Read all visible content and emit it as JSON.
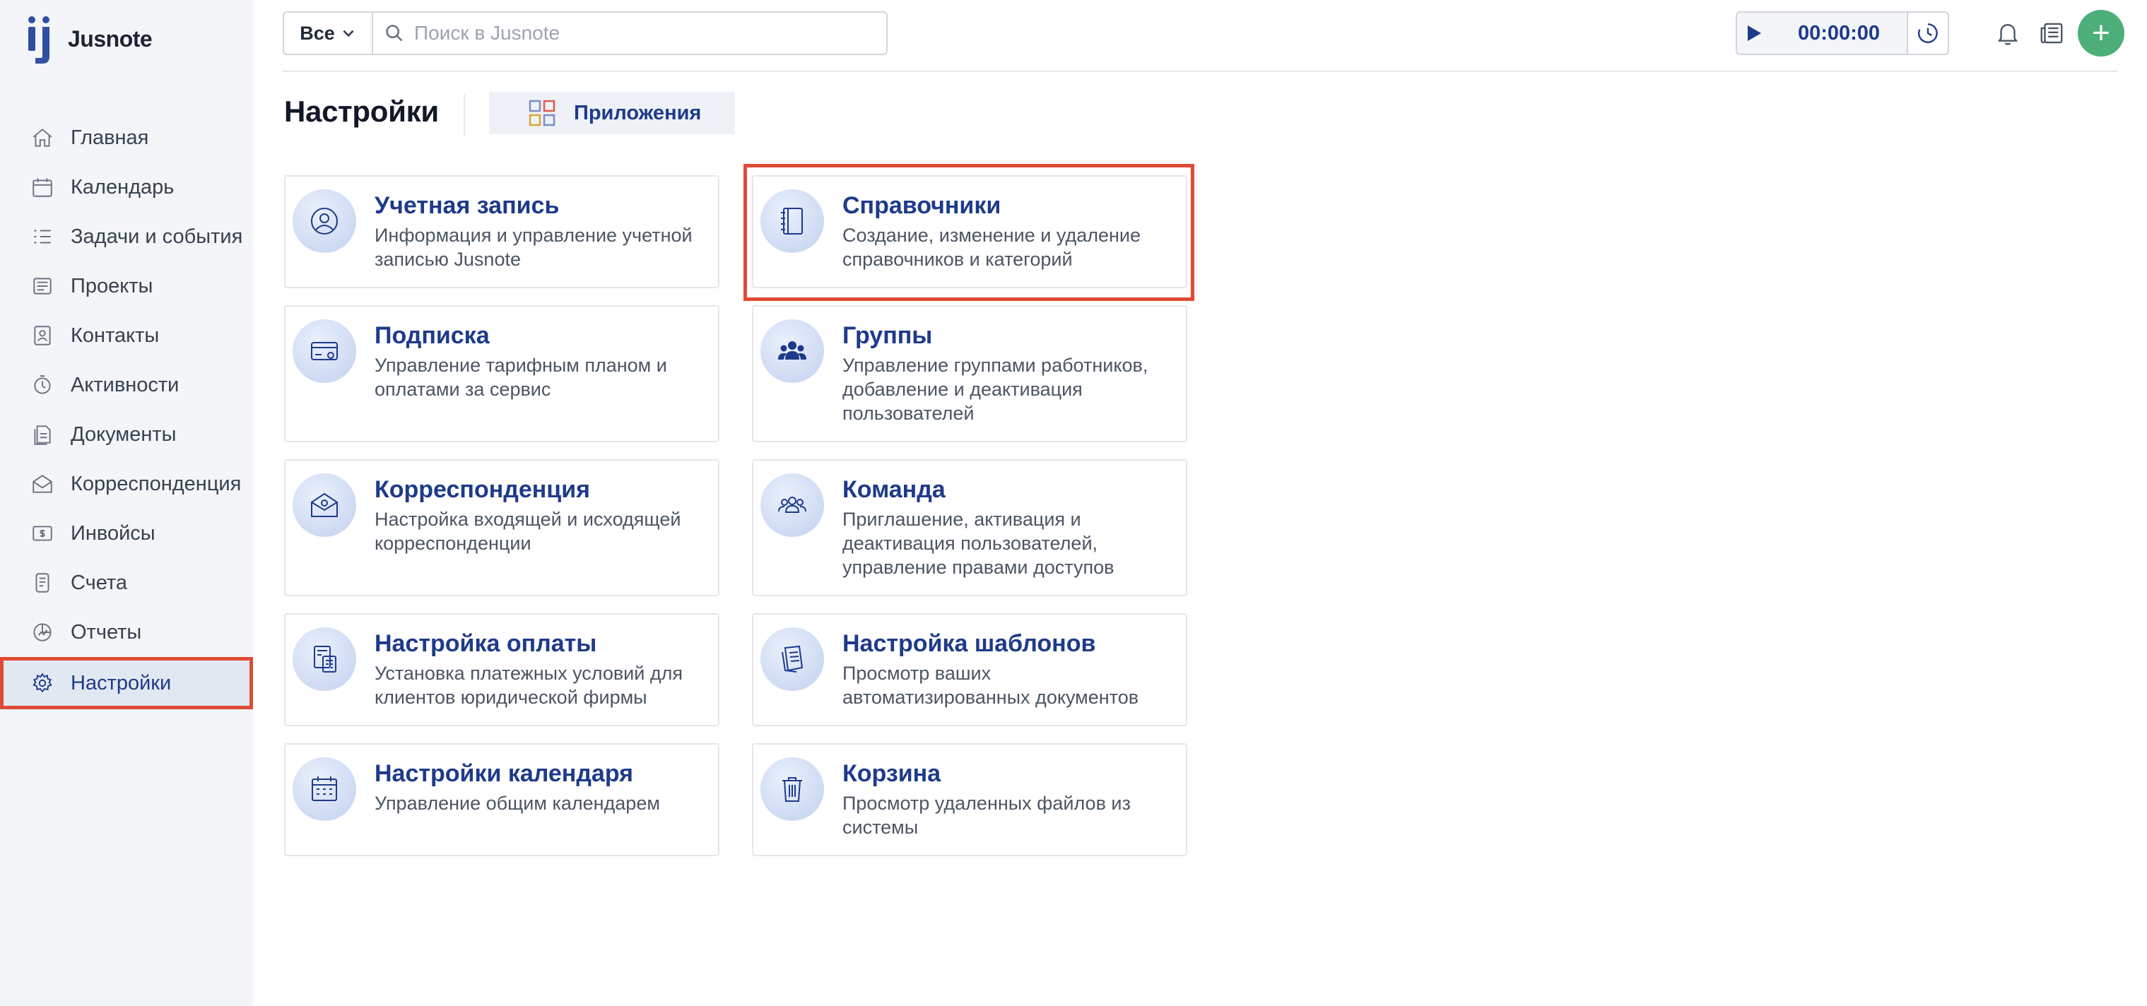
{
  "app": {
    "name": "Jusnote"
  },
  "search": {
    "filter_label": "Все",
    "placeholder": "Поиск в Jusnote"
  },
  "timer": {
    "time": "00:00:00"
  },
  "add_button_label": "+",
  "sidebar": {
    "items": [
      {
        "label": "Главная",
        "icon": "home-icon"
      },
      {
        "label": "Календарь",
        "icon": "calendar-icon"
      },
      {
        "label": "Задачи и события",
        "icon": "tasks-icon"
      },
      {
        "label": "Проекты",
        "icon": "projects-icon"
      },
      {
        "label": "Контакты",
        "icon": "contacts-icon"
      },
      {
        "label": "Активности",
        "icon": "activity-icon"
      },
      {
        "label": "Документы",
        "icon": "documents-icon"
      },
      {
        "label": "Корреспонденция",
        "icon": "mail-icon"
      },
      {
        "label": "Инвойсы",
        "icon": "invoice-icon"
      },
      {
        "label": "Счета",
        "icon": "bills-icon"
      },
      {
        "label": "Отчеты",
        "icon": "reports-icon"
      },
      {
        "label": "Настройки",
        "icon": "gear-icon",
        "active": true
      }
    ]
  },
  "page": {
    "title": "Настройки",
    "apps_tab": "Приложения"
  },
  "cards": [
    {
      "title": "Учетная запись",
      "desc": "Информация и управление учетной записью Jusnote",
      "icon": "account-icon"
    },
    {
      "title": "Справочники",
      "desc": "Создание, изменение и удаление справочников и категорий",
      "icon": "directory-icon"
    },
    {
      "title": "Подписка",
      "desc": "Управление тарифным планом и оплатами за сервис",
      "icon": "subscription-icon"
    },
    {
      "title": "Группы",
      "desc": "Управление группами работников, добавление и деактивация пользователей",
      "icon": "groups-icon"
    },
    {
      "title": "Корреспонденция",
      "desc": "Настройка входящей и исходящей корреспонденции",
      "icon": "correspondence-icon"
    },
    {
      "title": "Команда",
      "desc": "Приглашение, активация и деактивация пользователей, управление правами доступов",
      "icon": "team-icon"
    },
    {
      "title": "Настройка оплаты",
      "desc": "Установка платежных условий для клиентов юридической фирмы",
      "icon": "payment-icon"
    },
    {
      "title": "Настройка шаблонов",
      "desc": "Просмотр ваших автоматизированных документов",
      "icon": "templates-icon"
    },
    {
      "title": "Настройки календаря",
      "desc": "Управление общим календарем",
      "icon": "calendar-settings-icon"
    },
    {
      "title": "Корзина",
      "desc": "Просмотр удаленных файлов из системы",
      "icon": "trash-icon"
    }
  ],
  "colors": {
    "accent": "#1e3a8a",
    "highlight": "#e04a35",
    "add": "#4caf7a"
  }
}
